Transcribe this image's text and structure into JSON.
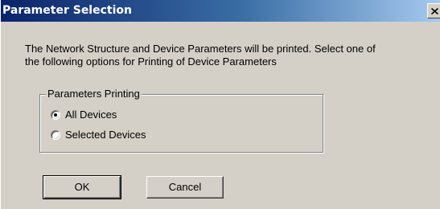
{
  "window": {
    "title": "Parameter Selection",
    "close_glyph": "X"
  },
  "message": {
    "line1": "The Network Structure and Device Parameters will be printed. Select one of",
    "line2": "the following options for Printing of Device Parameters"
  },
  "group": {
    "legend": "Parameters Printing",
    "options": [
      {
        "label": "All Devices",
        "selected": true
      },
      {
        "label": "Selected Devices",
        "selected": false
      }
    ]
  },
  "buttons": {
    "ok_label": "OK",
    "cancel_label": "Cancel"
  },
  "colors": {
    "titlebar_start": "#0a246a",
    "titlebar_end": "#a6caf0",
    "dialog_face": "#d4d0c8"
  }
}
